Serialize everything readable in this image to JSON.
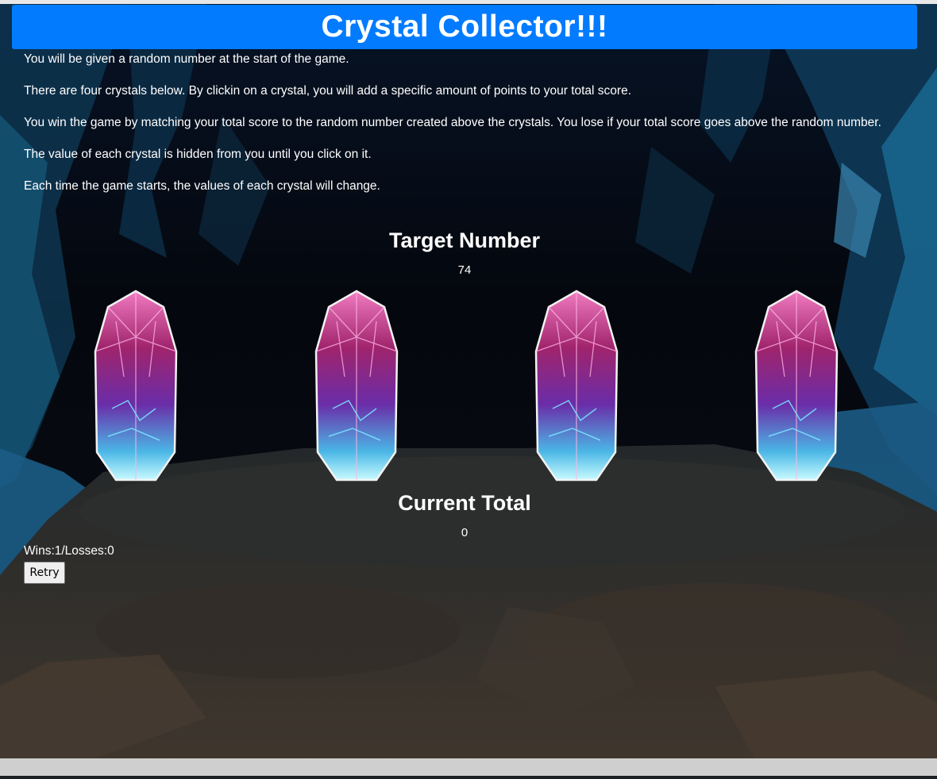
{
  "header": {
    "title": "Crystal Collector!!!"
  },
  "intro": [
    "You will be given a random number at the start of the game.",
    "There are four crystals below. By clickin on a crystal, you will add a specific amount of points to your total score.",
    "You win the game by matching your total score to the random number created above the crystals. You lose if your total score goes above the random number.",
    "The value of each crystal is hidden from you until you click on it.",
    "Each time the game starts, the values of each crystal will change."
  ],
  "target": {
    "label": "Target Number",
    "value": "74"
  },
  "current": {
    "label": "Current Total",
    "value": "0"
  },
  "score": {
    "text": "Wins:1/Losses:0"
  },
  "retry_label": "Retry",
  "crystals": [
    {
      "icon": "crystal-icon"
    },
    {
      "icon": "crystal-icon"
    },
    {
      "icon": "crystal-icon"
    },
    {
      "icon": "crystal-icon"
    }
  ],
  "colors": {
    "header": "#037bff",
    "crystal_top": "#d8459a",
    "crystal_bottom": "#7ee8f8"
  }
}
